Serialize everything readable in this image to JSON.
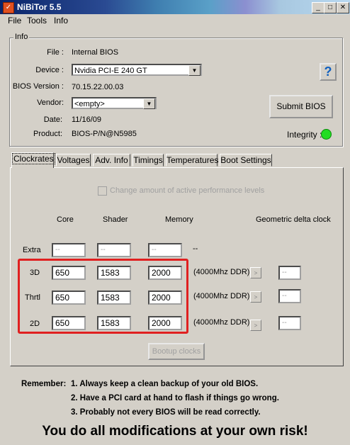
{
  "window": {
    "title": "NiBiTor 5.5",
    "buttons": {
      "minimize": "_",
      "maximize": "□",
      "close": "✕"
    }
  },
  "menu": {
    "file": "File",
    "tools": "Tools",
    "info": "Info"
  },
  "info": {
    "group_label": "Info",
    "file_label": "File :",
    "file_value": "Internal BIOS",
    "device_label": "Device :",
    "device_value": "Nvidia PCI-E 240 GT",
    "bios_version_label": "BIOS Version :",
    "bios_version_value": "70.15.22.00.03",
    "vendor_label": "Vendor:",
    "vendor_value": "<empty>",
    "date_label": "Date:",
    "date_value": "11/16/09",
    "product_label": "Product:",
    "product_value": "BIOS-P/N@N5985",
    "help_icon": "?",
    "submit_label": "Submit BIOS",
    "integrity_label": "Integrity :",
    "integrity_color": "#22dd22"
  },
  "tabs": [
    "Clockrates",
    "Voltages",
    "Adv. Info",
    "Timings",
    "Temperatures",
    "Boot Settings"
  ],
  "clockrates": {
    "checkbox_label": "Change amount of active performance levels",
    "headers": {
      "core": "Core",
      "shader": "Shader",
      "memory": "Memory",
      "geometric": "Geometric delta clock"
    },
    "extra": {
      "label": "Extra",
      "core": "--",
      "shader": "--",
      "memory": "--",
      "ddr": "--"
    },
    "rows": [
      {
        "label": "3D",
        "core": "650",
        "shader": "1583",
        "memory": "2000",
        "ddr": "(4000Mhz DDR)",
        "arrow": ">",
        "geo": "--"
      },
      {
        "label": "Thrtl",
        "core": "650",
        "shader": "1583",
        "memory": "2000",
        "ddr": "(4000Mhz DDR)",
        "arrow": ">",
        "geo": "--"
      },
      {
        "label": "2D",
        "core": "650",
        "shader": "1583",
        "memory": "2000",
        "ddr": "(4000Mhz DDR)",
        "arrow": ">",
        "geo": "--"
      }
    ],
    "bootup_label": "Bootup clocks",
    "highlight_color": "#e02020"
  },
  "notes": {
    "remember": "Remember:",
    "line1": "1. Always keep a clean backup of your old BIOS.",
    "line2": "2. Have a PCI card at hand to flash if things go wrong.",
    "line3": "3. Probably not every BIOS will be read correctly.",
    "warning": "You do all modifications at your own risk!"
  }
}
